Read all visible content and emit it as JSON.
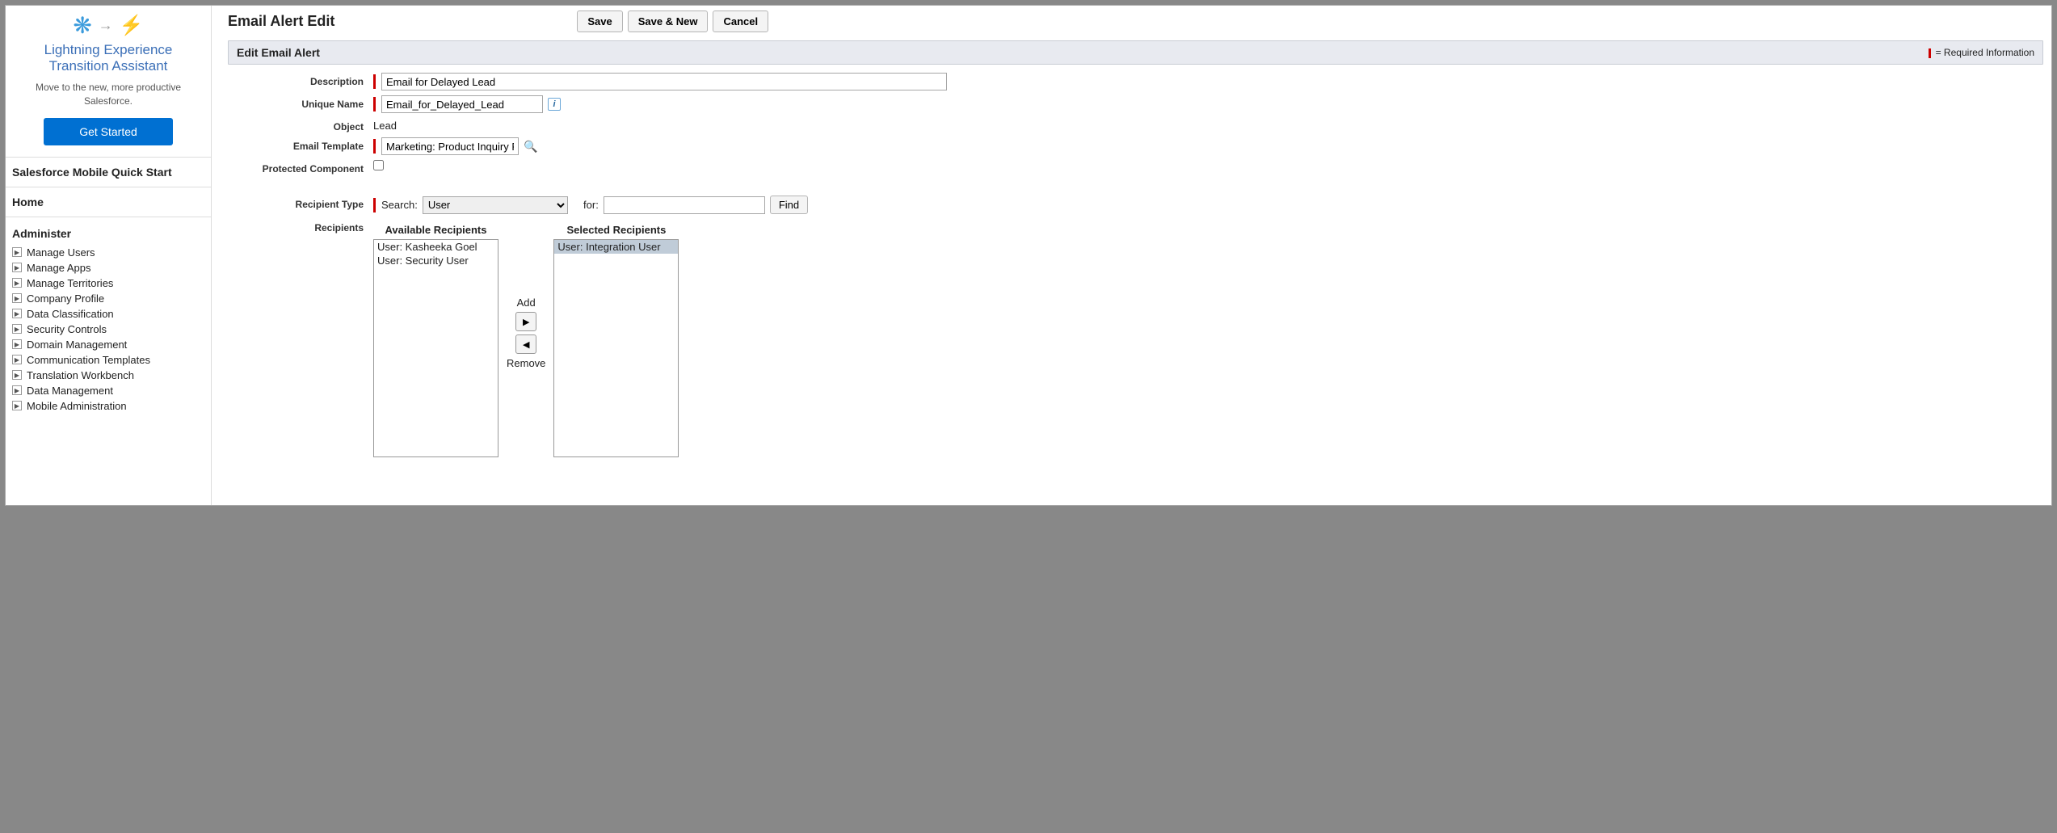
{
  "sidebar": {
    "promo": {
      "title": "Lightning Experience Transition Assistant",
      "subtitle": "Move to the new, more productive Salesforce.",
      "cta": "Get Started"
    },
    "quickstart": "Salesforce Mobile Quick Start",
    "home": "Home",
    "admin_header": "Administer",
    "admin_items": [
      "Manage Users",
      "Manage Apps",
      "Manage Territories",
      "Company Profile",
      "Data Classification",
      "Security Controls",
      "Domain Management",
      "Communication Templates",
      "Translation Workbench",
      "Data Management",
      "Mobile Administration"
    ]
  },
  "page": {
    "title": "Email Alert Edit",
    "buttons": {
      "save": "Save",
      "save_new": "Save & New",
      "cancel": "Cancel"
    },
    "section_title": "Edit Email Alert",
    "required_text": "= Required Information"
  },
  "form": {
    "labels": {
      "description": "Description",
      "unique_name": "Unique Name",
      "object": "Object",
      "email_template": "Email Template",
      "protected": "Protected Component",
      "recipient_type": "Recipient Type",
      "recipients": "Recipients",
      "search": "Search:",
      "for": "for:",
      "find": "Find",
      "available": "Available Recipients",
      "selected": "Selected Recipients",
      "add": "Add",
      "remove": "Remove"
    },
    "values": {
      "description": "Email for Delayed Lead",
      "unique_name": "Email_for_Delayed_Lead",
      "object": "Lead",
      "email_template": "Marketing: Product Inquiry R",
      "search_type": "User",
      "for_value": ""
    },
    "available_recipients": [
      "User: Kasheeka Goel",
      "User: Security User"
    ],
    "selected_recipients": [
      "User: Integration User"
    ]
  }
}
